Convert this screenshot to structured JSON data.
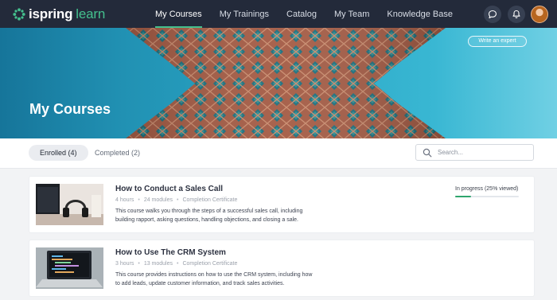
{
  "header": {
    "logo_word1": "ispring",
    "logo_word2": "learn",
    "nav": [
      {
        "label": "My Courses",
        "active": true
      },
      {
        "label": "My Trainings",
        "active": false
      },
      {
        "label": "Catalog",
        "active": false
      },
      {
        "label": "My Team",
        "active": false
      },
      {
        "label": "Knowledge Base",
        "active": false
      }
    ],
    "icons": [
      "chat-icon",
      "bell-icon",
      "avatar"
    ]
  },
  "hero": {
    "title": "My Courses",
    "button_label": "Write an expert"
  },
  "tabs": [
    {
      "label": "Enrolled (4)",
      "active": true
    },
    {
      "label": "Completed (2)",
      "active": false
    }
  ],
  "search": {
    "placeholder": "Search..."
  },
  "courses": [
    {
      "title": "How to Conduct a Sales Call",
      "duration": "4 hours",
      "modules": "24 modules",
      "certificate": "Completion Certificate",
      "description": "This course walks you through the steps of a successful sales call, including building rapport, asking questions, handling objections, and closing a sale.",
      "progress_label": "In progress (25% viewed)",
      "progress": 0.25
    },
    {
      "title": "How to Use The CRM System",
      "duration": "3 hours",
      "modules": "13 modules",
      "certificate": "Completion Certificate",
      "description": "This course provides instructions on how to use the CRM system, including how to add leads, update customer information, and track sales activities."
    }
  ],
  "colors": {
    "topbar": "#232a3a",
    "accent": "#44c08e",
    "progress": "#2fa66d"
  }
}
